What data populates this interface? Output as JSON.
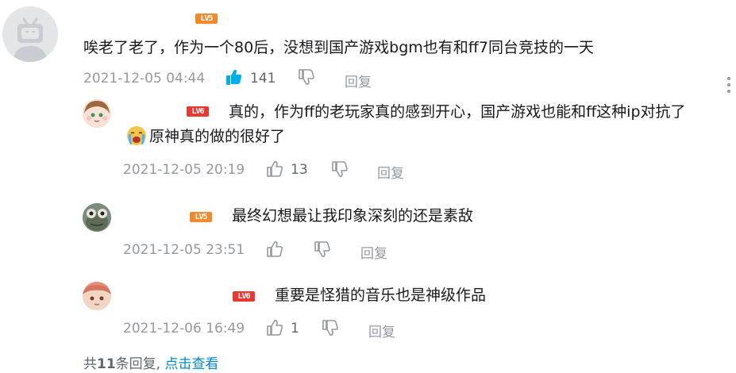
{
  "comment": {
    "level": "LV5",
    "text": "唉老了老了，作为一个80后，没想到国产游戏bgm也有和ff7同台竞技的一天",
    "time": "2021-12-05 04:44",
    "likes": "141",
    "reply_label": "回复",
    "liked": true
  },
  "replies": [
    {
      "level": "LV6",
      "text_line1": "真的，作为ff的老玩家真的感到开心，国产游戏也能和ff这种ip对抗了",
      "text_line2": "原神真的做的很好了",
      "time": "2021-12-05 20:19",
      "likes": "13",
      "reply_label": "回复"
    },
    {
      "level": "LV5",
      "text_line1": "最终幻想最让我印象深刻的还是素敌",
      "time": "2021-12-05 23:51",
      "likes": "",
      "reply_label": "回复"
    },
    {
      "level": "LV6",
      "text_line1": "重要是怪猎的音乐也是神级作品",
      "time": "2021-12-06 16:49",
      "likes": "1",
      "reply_label": "回复"
    }
  ],
  "footer": {
    "prefix": "共",
    "count": "11",
    "suffix": "条回复,",
    "view_link": "点击查看"
  },
  "colors": {
    "accent": "#008ac5",
    "liked": "#00aeec",
    "meta": "#9499a0",
    "lv5": "#f08a2c",
    "lv6": "#e9382f"
  }
}
